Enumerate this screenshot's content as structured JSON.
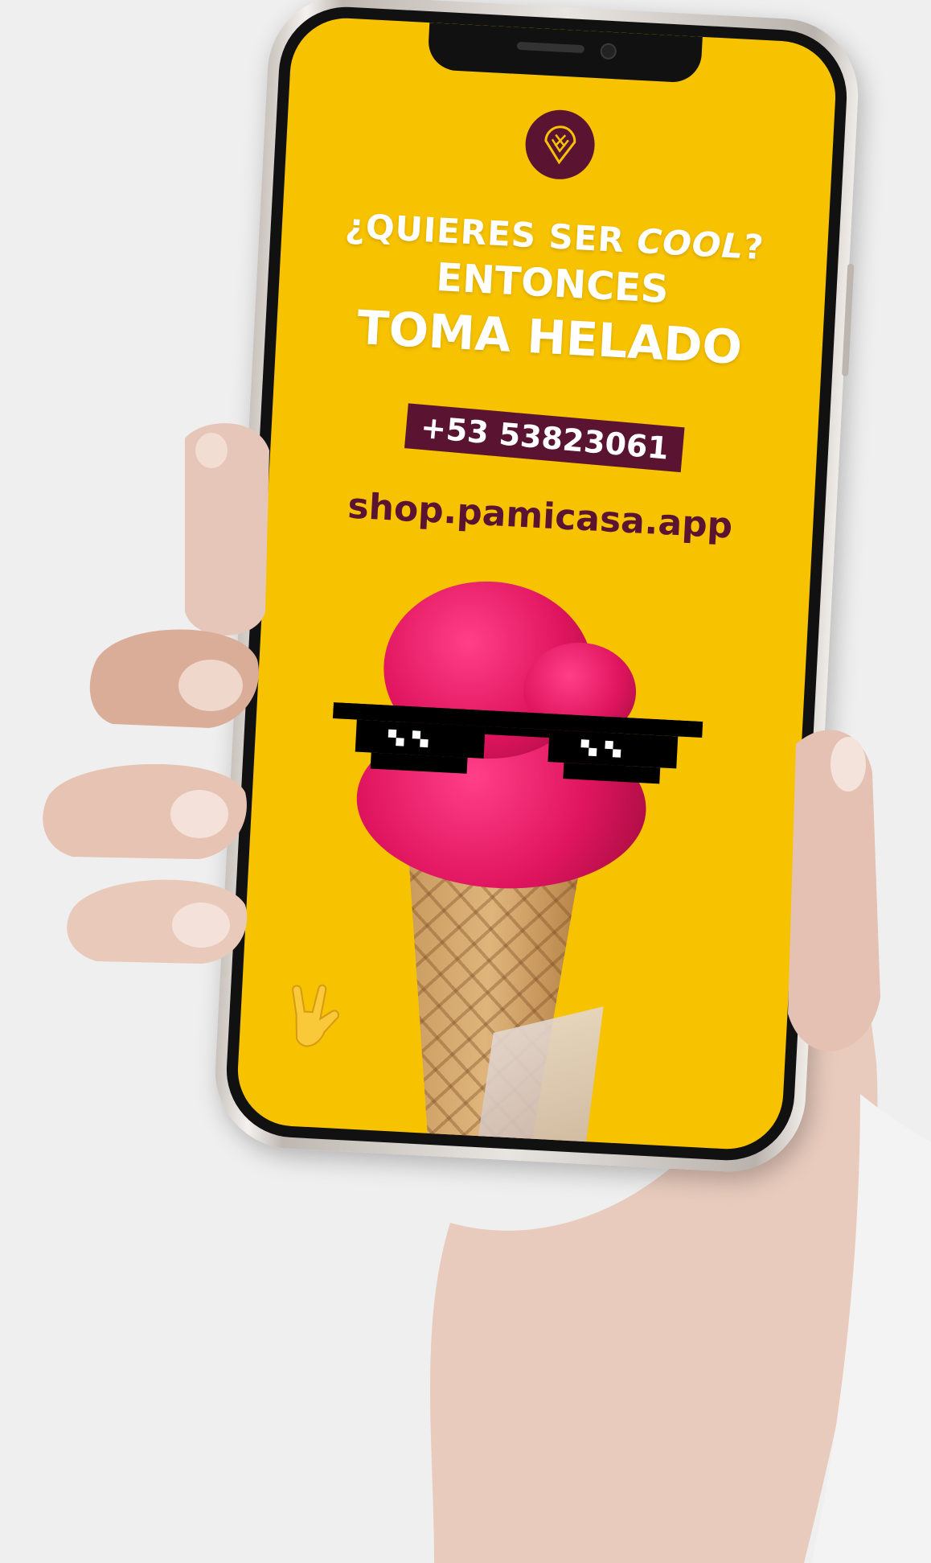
{
  "ad": {
    "headline_line1_prefix": "¿QUIERES SER ",
    "headline_line1_italic": "COOL",
    "headline_line1_suffix": "?",
    "headline_line2": "ENTONCES",
    "headline_line3": "TOMA HELADO",
    "phone_number": "+53 53823061",
    "website": "shop.pamicasa.app"
  },
  "colors": {
    "screen_background": "#f7c200",
    "brand": "#5a1431",
    "headline_text": "#ffffff",
    "ice_cream": "#e0155f"
  },
  "icons": [
    "brand-logo-icon",
    "pixel-sunglasses-icon",
    "rock-hand-emoji-icon"
  ]
}
